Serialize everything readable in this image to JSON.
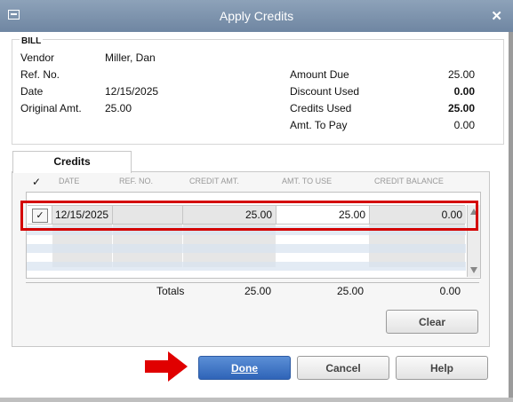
{
  "window": {
    "title": "Apply Credits",
    "close_icon": "close-icon",
    "menu_icon": "window-menu-icon"
  },
  "bill": {
    "legend": "BILL",
    "vendor_label": "Vendor",
    "vendor_value": "Miller, Dan",
    "refno_label": "Ref. No.",
    "refno_value": "",
    "date_label": "Date",
    "date_value": "12/15/2025",
    "orig_label": "Original Amt.",
    "orig_value": "25.00",
    "amount_due_label": "Amount Due",
    "amount_due_value": "25.00",
    "discount_used_label": "Discount Used",
    "discount_used_value": "0.00",
    "credits_used_label": "Credits Used",
    "credits_used_value": "25.00",
    "amt_to_pay_label": "Amt. To Pay",
    "amt_to_pay_value": "0.00"
  },
  "credits": {
    "tab_label": "Credits",
    "headers": [
      "✓",
      "DATE",
      "REF. NO.",
      "CREDIT AMT.",
      "AMT. TO USE",
      "CREDIT BALANCE"
    ],
    "rows": [
      {
        "checked": "✓",
        "date": "12/15/2025",
        "ref": "",
        "credit_amt": "25.00",
        "amt_to_use": "25.00",
        "credit_balance": "0.00"
      }
    ],
    "totals_label": "Totals",
    "totals_credit_amt": "25.00",
    "totals_amt_to_use": "25.00",
    "totals_credit_balance": "0.00",
    "clear_label": "Clear"
  },
  "buttons": {
    "done": "Done",
    "cancel": "Cancel",
    "help": "Help"
  },
  "colors": {
    "highlight": "#d40000",
    "arrow": "#e00000",
    "accent": "#2f64b8"
  }
}
